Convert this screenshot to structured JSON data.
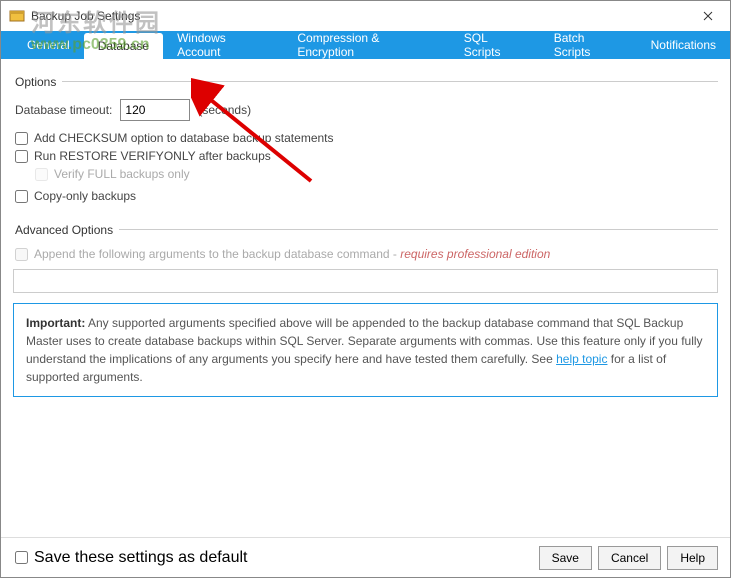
{
  "window": {
    "title": "Backup Job Settings"
  },
  "watermark": {
    "cn": "河东软件园",
    "url": "www.pc0359.cn"
  },
  "tabs": {
    "general": "General",
    "database": "Database",
    "windows_account": "Windows Account",
    "compression": "Compression & Encryption",
    "sql_scripts": "SQL Scripts",
    "batch_scripts": "Batch Scripts",
    "notifications": "Notifications"
  },
  "options": {
    "legend": "Options",
    "timeout_label": "Database timeout:",
    "timeout_value": "120",
    "timeout_unit": "(seconds)",
    "add_checksum": "Add CHECKSUM option to database backup statements",
    "run_restore": "Run RESTORE VERIFYONLY after backups",
    "verify_full": "Verify FULL backups only",
    "copy_only": "Copy-only backups"
  },
  "advanced": {
    "legend": "Advanced Options",
    "append_args": "Append the following arguments to the backup database command - ",
    "requires_pro": "requires professional edition",
    "info_bold": "Important:",
    "info_text": " Any supported arguments specified above will be appended to the backup database command that SQL Backup Master uses to create database backups within SQL Server. Separate arguments with commas. Use this feature only if you fully understand the implications of any arguments you specify here and have tested them carefully. See ",
    "info_link": "help topic",
    "info_tail": " for a list of supported arguments."
  },
  "footer": {
    "save_default": "Save these settings as default",
    "save": "Save",
    "cancel": "Cancel",
    "help": "Help"
  }
}
